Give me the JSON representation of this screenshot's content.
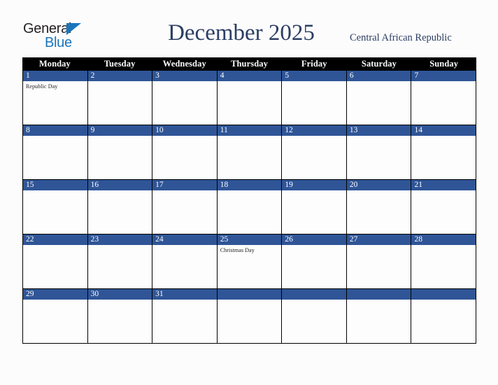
{
  "brand": {
    "name_part1": "General",
    "name_part2": "Blue",
    "color_dark": "#231f20",
    "color_blue": "#1b75bb"
  },
  "header": {
    "title": "December 2025",
    "subtitle": "Central African Republic",
    "title_color": "#2c3e63"
  },
  "calendar": {
    "accent_color": "#2f5597",
    "header_bg": "#000000",
    "day_names": [
      "Monday",
      "Tuesday",
      "Wednesday",
      "Thursday",
      "Friday",
      "Saturday",
      "Sunday"
    ],
    "weeks": [
      [
        {
          "date": "1",
          "events": [
            "Republic Day"
          ]
        },
        {
          "date": "2",
          "events": []
        },
        {
          "date": "3",
          "events": []
        },
        {
          "date": "4",
          "events": []
        },
        {
          "date": "5",
          "events": []
        },
        {
          "date": "6",
          "events": []
        },
        {
          "date": "7",
          "events": []
        }
      ],
      [
        {
          "date": "8",
          "events": []
        },
        {
          "date": "9",
          "events": []
        },
        {
          "date": "10",
          "events": []
        },
        {
          "date": "11",
          "events": []
        },
        {
          "date": "12",
          "events": []
        },
        {
          "date": "13",
          "events": []
        },
        {
          "date": "14",
          "events": []
        }
      ],
      [
        {
          "date": "15",
          "events": []
        },
        {
          "date": "16",
          "events": []
        },
        {
          "date": "17",
          "events": []
        },
        {
          "date": "18",
          "events": []
        },
        {
          "date": "19",
          "events": []
        },
        {
          "date": "20",
          "events": []
        },
        {
          "date": "21",
          "events": []
        }
      ],
      [
        {
          "date": "22",
          "events": []
        },
        {
          "date": "23",
          "events": []
        },
        {
          "date": "24",
          "events": []
        },
        {
          "date": "25",
          "events": [
            "Christmas Day"
          ]
        },
        {
          "date": "26",
          "events": []
        },
        {
          "date": "27",
          "events": []
        },
        {
          "date": "28",
          "events": []
        }
      ],
      [
        {
          "date": "29",
          "events": []
        },
        {
          "date": "30",
          "events": []
        },
        {
          "date": "31",
          "events": []
        },
        {
          "date": "",
          "events": []
        },
        {
          "date": "",
          "events": []
        },
        {
          "date": "",
          "events": []
        },
        {
          "date": "",
          "events": []
        }
      ]
    ]
  }
}
